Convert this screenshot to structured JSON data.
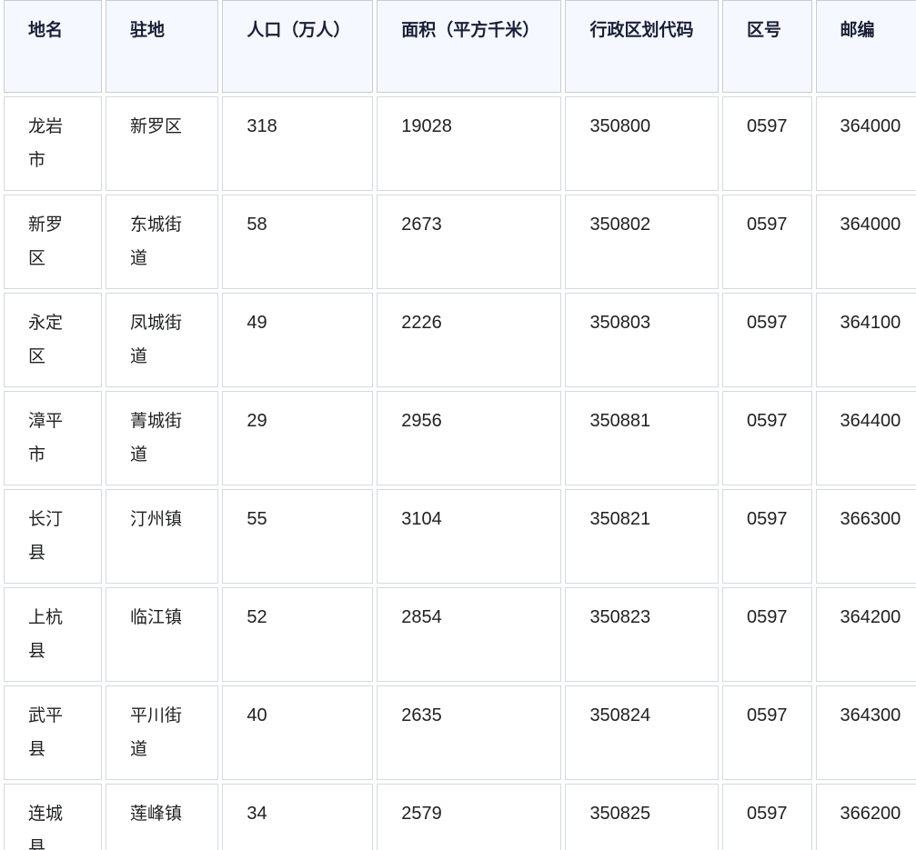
{
  "table": {
    "headers": [
      "地名",
      "驻地",
      "人口（万人）",
      "面积（平方千米）",
      "行政区划代码",
      "区号",
      "邮编"
    ],
    "rows": [
      [
        "龙岩市",
        "新罗区",
        "318",
        "19028",
        "350800",
        "0597",
        "364000"
      ],
      [
        "新罗区",
        "东城街道",
        "58",
        "2673",
        "350802",
        "0597",
        "364000"
      ],
      [
        "永定区",
        "凤城街道",
        "49",
        "2226",
        "350803",
        "0597",
        "364100"
      ],
      [
        "漳平市",
        "菁城街道",
        "29",
        "2956",
        "350881",
        "0597",
        "364400"
      ],
      [
        "长汀县",
        "汀州镇",
        "55",
        "3104",
        "350821",
        "0597",
        "366300"
      ],
      [
        "上杭县",
        "临江镇",
        "52",
        "2854",
        "350823",
        "0597",
        "364200"
      ],
      [
        "武平县",
        "平川街道",
        "40",
        "2635",
        "350824",
        "0597",
        "364300"
      ],
      [
        "连城县",
        "莲峰镇",
        "34",
        "2579",
        "350825",
        "0597",
        "366200"
      ]
    ]
  }
}
